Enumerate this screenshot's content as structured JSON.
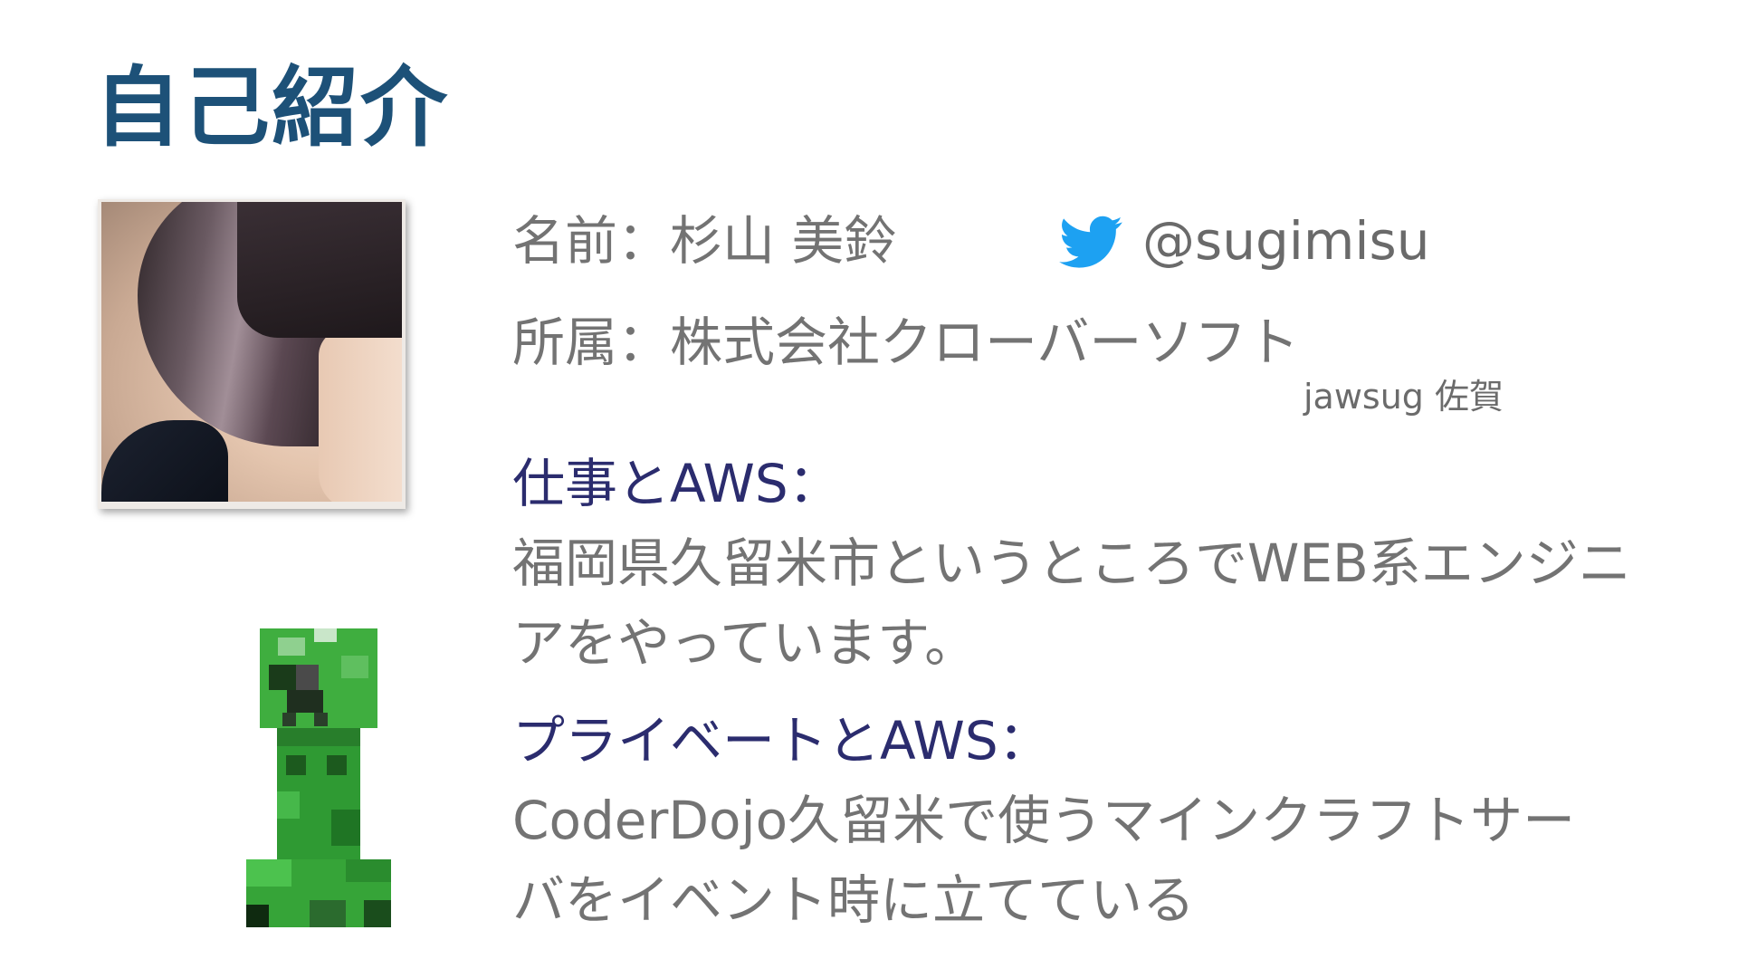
{
  "slide": {
    "title": "自己紹介"
  },
  "profile": {
    "name_line": "名前：杉山 美鈴",
    "twitter_handle": "@sugimisu",
    "affiliation_line": "所属：株式会社クローバーソフト",
    "community": "jawsug 佐賀",
    "work_heading": "仕事とAWS：",
    "work_text_1": "福岡県久留米市というところでWEB系エンジニ",
    "work_text_2": "アをやっています。",
    "private_heading": "プライベートとAWS：",
    "private_text_1": " CoderDojo久留米で使うマインクラフトサー",
    "private_text_2": "バをイベント時に立てている"
  },
  "icons": {
    "twitter": "twitter-bird-icon",
    "twitter_color": "#1da1f2"
  },
  "colors": {
    "title": "#1d5178",
    "heading": "#2b2c6e",
    "body_text": "#737373"
  }
}
